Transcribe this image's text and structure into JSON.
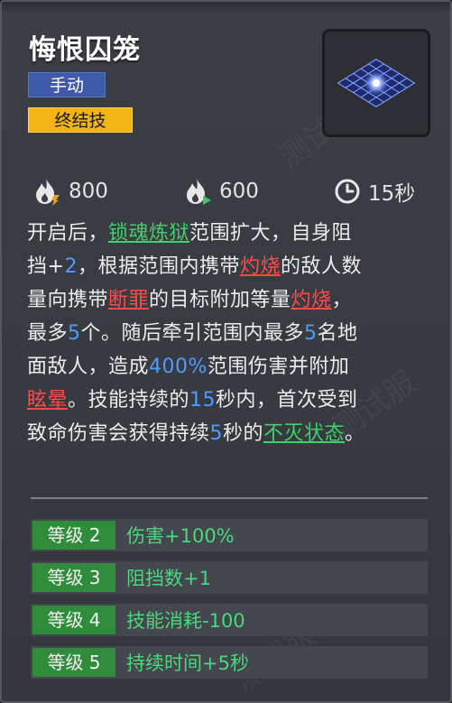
{
  "skill": {
    "title": "悔恨囚笼",
    "tags": {
      "manual": "手动",
      "ultimate": "终结技"
    }
  },
  "stats": {
    "cost1": {
      "icon": "flame-cost-icon",
      "value": "800"
    },
    "cost2": {
      "icon": "flame-regen-icon",
      "value": "600"
    },
    "duration": {
      "icon": "clock-icon",
      "value": "15秒"
    }
  },
  "description": {
    "l1a": "开启后，",
    "l1kw": "锁魂炼狱",
    "l1b": "范围扩大，自身阻",
    "l2a": "挡+",
    "l2n": "2",
    "l2b": "，根据范围内携带",
    "l2kw": "灼烧",
    "l2c": "的敌人数",
    "l3a": "量向携带",
    "l3kw1": "断罪",
    "l3b": "的目标附加等量",
    "l3kw2": "灼烧",
    "l3c": "，",
    "l4a": "最多",
    "l4n1": "5",
    "l4b": "个。随后牵引范围内最多",
    "l4n2": "5",
    "l4c": "名地",
    "l5a": "面敌人，造成",
    "l5n": "400%",
    "l5b": "范围伤害并附加",
    "l6kw": "眩晕",
    "l6a": "。技能持续的",
    "l6n": "15",
    "l6b": "秒内，首次受到",
    "l7a": "致命伤害会获得持续",
    "l7n": "5",
    "l7b": "秒的",
    "l7kw": "不灭状态",
    "l7c": "。"
  },
  "levels": [
    {
      "label": "等级 2",
      "effect": "伤害+100%"
    },
    {
      "label": "等级 3",
      "effect": "阻挡数+1"
    },
    {
      "label": "等级 4",
      "effect": "技能消耗-100"
    },
    {
      "label": "等级 5",
      "effect": "持续时间+5秒"
    }
  ],
  "watermark": "测试服",
  "colors": {
    "keyword_green": "#3fd06b",
    "keyword_red": "#ff4a4a",
    "number_blue": "#4e9bff",
    "manual_tag": "#3f5aa8",
    "ultimate_tag": "#f2b414",
    "level_badge": "#2f8c3a"
  }
}
